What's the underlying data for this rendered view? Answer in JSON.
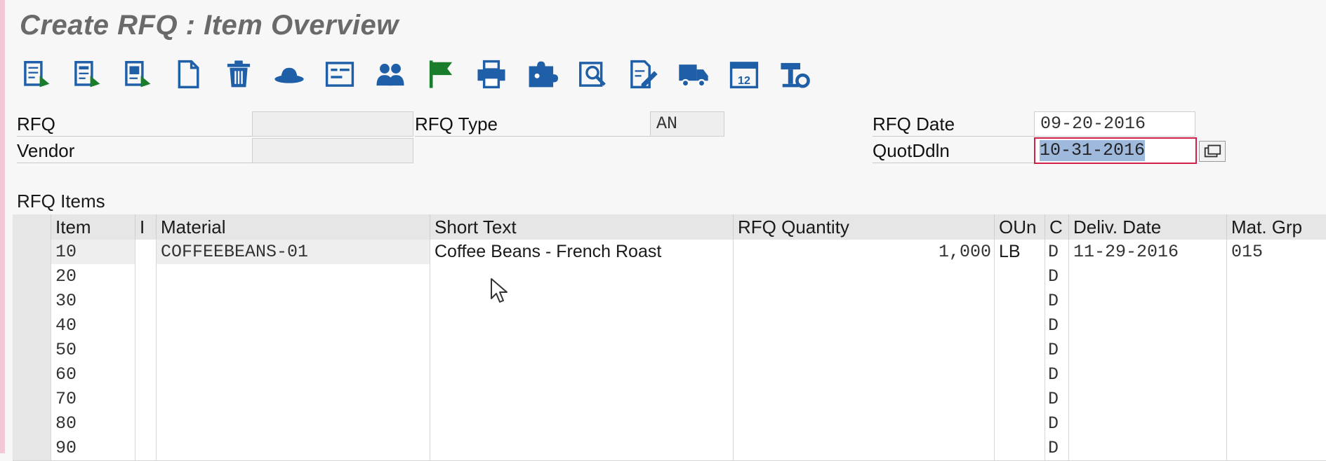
{
  "title": "Create RFQ : Item Overview",
  "toolbar": {
    "icons": [
      "header-details-icon",
      "item-details-icon",
      "header-texts-icon",
      "new-document-icon",
      "delete-icon",
      "hat-icon",
      "form-icon",
      "users-icon",
      "flag-icon",
      "print-icon",
      "puzzle-icon",
      "search-list-icon",
      "edit-icon",
      "truck-icon",
      "calendar-icon",
      "tools-icon"
    ]
  },
  "header": {
    "rfq_label": "RFQ",
    "rfq_value": "",
    "rfq_type_label": "RFQ Type",
    "rfq_type_value": "AN",
    "rfq_date_label": "RFQ Date",
    "rfq_date_value": "09-20-2016",
    "vendor_label": "Vendor",
    "vendor_value": "",
    "quot_label": "QuotDdln",
    "quot_value": "10-31-2016"
  },
  "items_label": "RFQ Items",
  "table": {
    "columns": [
      "Item",
      "I",
      "Material",
      "Short Text",
      "RFQ Quantity",
      "OUn",
      "C",
      "Deliv. Date",
      "Mat. Grp"
    ],
    "rows": [
      {
        "item": "10",
        "i": "",
        "material": "COFFEEBEANS-01",
        "short_text": "Coffee Beans - French Roast",
        "qty": "1,000",
        "oun": "LB",
        "c": "D",
        "date": "11-29-2016",
        "grp": "015"
      },
      {
        "item": "20",
        "i": "",
        "material": "",
        "short_text": "",
        "qty": "",
        "oun": "",
        "c": "D",
        "date": "",
        "grp": ""
      },
      {
        "item": "30",
        "i": "",
        "material": "",
        "short_text": "",
        "qty": "",
        "oun": "",
        "c": "D",
        "date": "",
        "grp": ""
      },
      {
        "item": "40",
        "i": "",
        "material": "",
        "short_text": "",
        "qty": "",
        "oun": "",
        "c": "D",
        "date": "",
        "grp": ""
      },
      {
        "item": "50",
        "i": "",
        "material": "",
        "short_text": "",
        "qty": "",
        "oun": "",
        "c": "D",
        "date": "",
        "grp": ""
      },
      {
        "item": "60",
        "i": "",
        "material": "",
        "short_text": "",
        "qty": "",
        "oun": "",
        "c": "D",
        "date": "",
        "grp": ""
      },
      {
        "item": "70",
        "i": "",
        "material": "",
        "short_text": "",
        "qty": "",
        "oun": "",
        "c": "D",
        "date": "",
        "grp": ""
      },
      {
        "item": "80",
        "i": "",
        "material": "",
        "short_text": "",
        "qty": "",
        "oun": "",
        "c": "D",
        "date": "",
        "grp": ""
      },
      {
        "item": "90",
        "i": "",
        "material": "",
        "short_text": "",
        "qty": "",
        "oun": "",
        "c": "D",
        "date": "",
        "grp": ""
      }
    ]
  },
  "colors": {
    "icon_blue": "#1f5fa8",
    "flag_green": "#1a7d2c",
    "selection": "#9fb9dc",
    "focus_red": "#d0204a"
  }
}
